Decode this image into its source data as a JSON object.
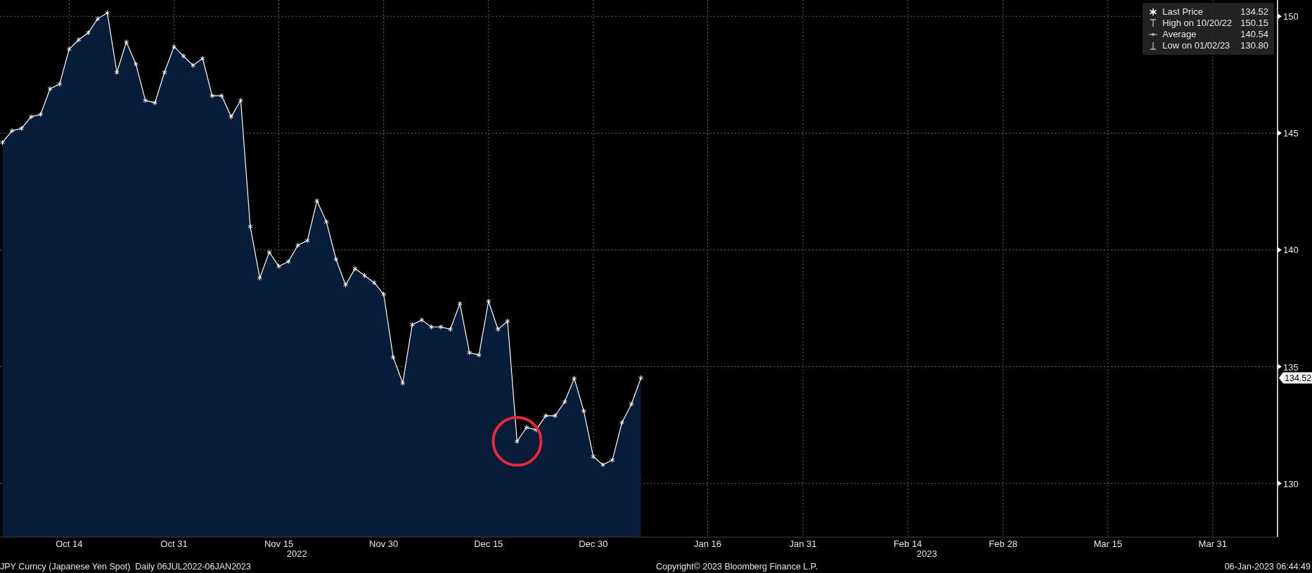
{
  "chart": {
    "legend": [
      {
        "kind": "last",
        "value": "134.52"
      },
      {
        "kind": "high",
        "label": "High on 10/20/22",
        "value": "150.15"
      },
      {
        "kind": "average",
        "label": "Average",
        "value": "140.54"
      },
      {
        "kind": "low",
        "label": "Low on 01/02/23",
        "value": "130.80"
      }
    ],
    "last_price_tag": "134.52",
    "year_labels": [
      "2022",
      "2023"
    ],
    "chart_data": {
      "type": "area",
      "categories": [
        null,
        null,
        null,
        null,
        null,
        null,
        null,
        "Oct 14",
        null,
        null,
        null,
        null,
        null,
        null,
        null,
        null,
        null,
        null,
        "Oct 31",
        null,
        null,
        null,
        null,
        null,
        null,
        null,
        null,
        null,
        null,
        "Nov 15",
        null,
        null,
        null,
        null,
        null,
        null,
        null,
        null,
        null,
        null,
        "Nov 30",
        null,
        null,
        null,
        null,
        null,
        null,
        null,
        null,
        null,
        null,
        "Dec 15",
        null,
        null,
        null,
        null,
        null,
        null,
        null,
        null,
        null,
        null,
        "Dec 30",
        null,
        null,
        null,
        null,
        null,
        null,
        null,
        null,
        null,
        null,
        null,
        "Jan 16",
        null,
        null,
        null,
        null,
        null,
        null,
        null,
        null,
        null,
        "Jan 31",
        null,
        null,
        null,
        null,
        null,
        null,
        null,
        null,
        null,
        null,
        "Feb 14",
        null,
        null,
        null,
        null,
        null,
        null,
        null,
        null,
        null,
        "Feb 28",
        null,
        null,
        null,
        null,
        null,
        null,
        null,
        null,
        null,
        null,
        "Mar 15",
        null,
        null,
        null,
        null,
        null,
        null,
        null,
        null,
        null,
        null,
        "Mar 31",
        null,
        null,
        null,
        null,
        null,
        null
      ],
      "series": [
        {
          "name": "Last Price",
          "color": "#ffffff",
          "values": [
            144.6,
            145.1,
            145.2,
            145.7,
            145.8,
            146.9,
            147.1,
            148.6,
            149.0,
            149.3,
            149.9,
            150.15,
            147.6,
            148.9,
            147.95,
            146.4,
            146.3,
            147.6,
            148.7,
            148.3,
            147.9,
            148.2,
            146.6,
            146.6,
            145.7,
            146.4,
            141.0,
            138.8,
            139.9,
            139.3,
            139.5,
            140.2,
            140.4,
            142.1,
            141.2,
            139.6,
            138.5,
            139.2,
            138.9,
            138.6,
            138.1,
            135.4,
            134.3,
            136.8,
            137.0,
            136.7,
            136.7,
            136.6,
            137.7,
            135.6,
            135.5,
            137.8,
            136.6,
            136.95,
            131.8,
            132.4,
            132.3,
            132.9,
            132.9,
            133.5,
            134.5,
            133.1,
            131.15,
            130.8,
            131.0,
            132.6,
            133.4,
            134.52,
            null,
            null,
            null,
            null,
            null,
            null,
            null,
            null,
            null,
            null,
            null,
            null,
            null,
            null,
            null,
            null,
            null,
            null,
            null,
            null,
            null,
            null,
            null,
            null,
            null,
            null,
            null,
            null,
            null,
            null,
            null,
            null,
            null,
            null,
            null,
            null,
            null,
            null,
            null,
            null,
            null,
            null,
            null,
            null,
            null,
            null,
            null,
            null,
            null,
            null,
            null,
            null,
            null,
            null,
            null,
            null,
            null,
            null,
            null,
            null,
            null,
            null,
            null,
            null,
            null,
            null
          ]
        }
      ],
      "ylim": [
        127.7,
        150.7
      ],
      "yticks": [
        130,
        135,
        140,
        145,
        150
      ],
      "grid": true
    },
    "highlight_circle": true
  },
  "status_bar": {
    "left": "JPY Curncy (Japanese Yen Spot)  Daily 06JUL2022-06JAN2023",
    "center": "Copyright© 2023 Bloomberg Finance L.P.",
    "right": "06-Jan-2023 06:44:49"
  }
}
